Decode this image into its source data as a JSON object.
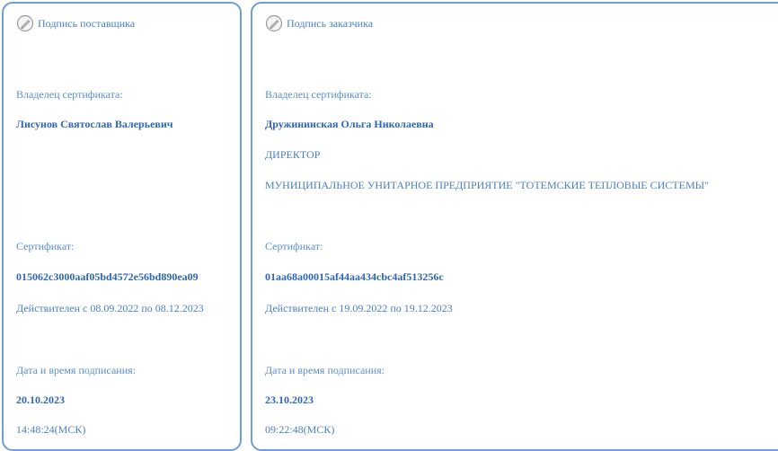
{
  "supplier": {
    "header": "Подпись поставщика",
    "owner_label": "Владелец сертификата:",
    "owner_name": "Лисунов Святослав Валерьевич",
    "cert_label": "Сертификат:",
    "cert_number": "015062c3000aaf05bd4572e56bd890ea09",
    "validity": "Действителен с 08.09.2022 по 08.12.2023",
    "date_label": "Дата и время подписания:",
    "date": "20.10.2023",
    "time": "14:48:24(МСК)"
  },
  "customer": {
    "header": "Подпись заказчика",
    "owner_label": "Владелец сертификата:",
    "owner_name": "Дружининская Ольга Николаевна",
    "position": "ДИРЕКТОР",
    "organization": "МУНИЦИПАЛЬНОЕ УНИТАРНОЕ ПРЕДПРИЯТИЕ \"ТОТЕМСКИЕ ТЕПЛОВЫЕ СИСТЕМЫ\"",
    "cert_label": "Сертификат:",
    "cert_number": "01aa68a00015af44aa434cbc4af513256c",
    "validity": "Действителен с 19.09.2022 по 19.12.2023",
    "date_label": "Дата и время подписания:",
    "date": "23.10.2023",
    "time": "09:22:48(МСК)"
  },
  "icons": {
    "signature": "pen-circle-icon"
  },
  "colors": {
    "border": "#6f9fd8",
    "text": "#4a7fc6",
    "bold_text": "#2f66b3"
  }
}
